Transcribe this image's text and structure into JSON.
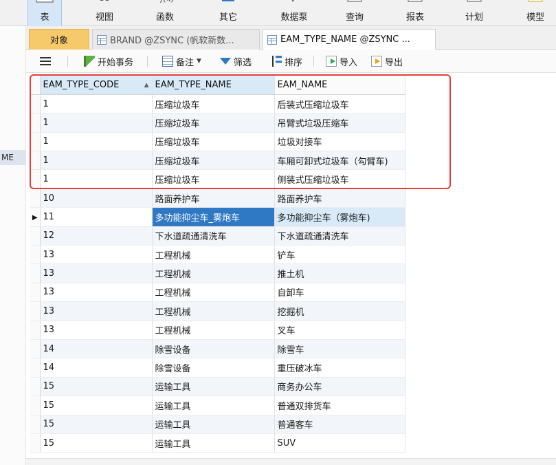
{
  "ribbon": {
    "items": [
      {
        "label": "表",
        "icon": "table-icon"
      },
      {
        "label": "视图",
        "icon": "view-icon"
      },
      {
        "label": "函数",
        "icon": "function-icon"
      },
      {
        "label": "其它",
        "icon": "other-icon"
      },
      {
        "label": "数据泵",
        "icon": "data-pump-icon"
      },
      {
        "label": "查询",
        "icon": "query-icon"
      },
      {
        "label": "报表",
        "icon": "report-icon"
      },
      {
        "label": "计划",
        "icon": "schedule-icon"
      },
      {
        "label": "模型",
        "icon": "model-icon"
      }
    ]
  },
  "left_panel": {
    "truncated_label": "ME"
  },
  "tabs": {
    "objects_label": "对象",
    "documents": [
      {
        "label": "BRAND @ZSYNC (帆软新数...",
        "icon": "table-icon"
      },
      {
        "label": "EAM_TYPE_NAME @ZSYNC ...",
        "icon": "table-icon"
      }
    ]
  },
  "toolbar": {
    "begin_transaction": "开始事务",
    "note": "备注",
    "filter": "筛选",
    "sort": "排序",
    "import": "导入",
    "export": "导出"
  },
  "grid": {
    "columns": [
      "EAM_TYPE_CODE",
      "EAM_TYPE_NAME",
      "EAM_NAME"
    ],
    "rows": [
      [
        "1",
        "压缩垃圾车",
        "后装式压缩垃圾车"
      ],
      [
        "1",
        "压缩垃圾车",
        "吊臂式垃圾压缩车"
      ],
      [
        "1",
        "压缩垃圾车",
        "垃圾对接车"
      ],
      [
        "1",
        "压缩垃圾车",
        "车厢可卸式垃圾车（勾臂车)"
      ],
      [
        "1",
        "压缩垃圾车",
        "侧装式压缩垃圾车"
      ],
      [
        "10",
        "路面养护车",
        "路面养护车"
      ],
      [
        "11",
        "多功能抑尘车_雾炮车",
        "多功能抑尘车（雾炮车)"
      ],
      [
        "12",
        "下水道疏通清洗车",
        "下水道疏通清洗车"
      ],
      [
        "13",
        "工程机械",
        "铲车"
      ],
      [
        "13",
        "工程机械",
        "推土机"
      ],
      [
        "13",
        "工程机械",
        "自卸车"
      ],
      [
        "13",
        "工程机械",
        "挖掘机"
      ],
      [
        "13",
        "工程机械",
        "叉车"
      ],
      [
        "14",
        "除雪设备",
        "除雪车"
      ],
      [
        "14",
        "除雪设备",
        "重压破冰车"
      ],
      [
        "15",
        "运输工具",
        "商务办公车"
      ],
      [
        "15",
        "运输工具",
        "普通双排货车"
      ],
      [
        "15",
        "运输工具",
        "普通客车"
      ],
      [
        "15",
        "运输工具",
        "SUV"
      ]
    ],
    "selected_row_index": 6,
    "selected_column_index": 1,
    "sorted_column_index": 0
  },
  "colors": {
    "objects_tab": "#f6c96a",
    "selection": "#2f78c4",
    "highlight_box": "#ec3b3b",
    "header_sorted": "#d8eaf8"
  }
}
